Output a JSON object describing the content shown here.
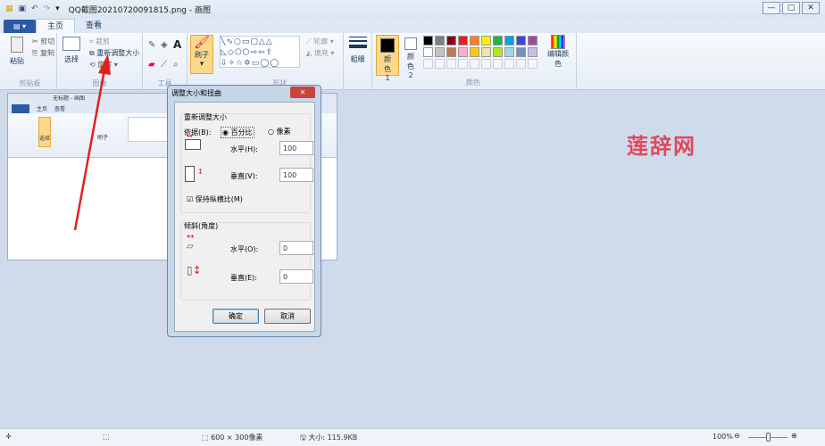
{
  "window": {
    "title": "QQ截图20210720091815.png - 画图",
    "min": "—",
    "max": "▢",
    "close": "✕"
  },
  "tabs": [
    {
      "label": "主页"
    },
    {
      "label": "查看"
    }
  ],
  "ribbon": {
    "clipboard": {
      "paste": "粘贴",
      "cut": "剪切",
      "copy": "复制",
      "label": "剪贴板"
    },
    "image": {
      "select": "选择",
      "crop": "裁剪",
      "resize": "重新调整大小",
      "rotate": "旋转",
      "label": "图像"
    },
    "tools": {
      "label": "工具",
      "text_icon": "A"
    },
    "brushes": {
      "label": "刷子"
    },
    "shapes": {
      "label": "形状",
      "outline": "轮廓",
      "fill": "填充"
    },
    "size": {
      "label": "粗细"
    },
    "colors": {
      "color1": "颜色 1",
      "color2": "颜色 2",
      "edit": "编辑颜色",
      "label": "颜色",
      "palette_row1": [
        "#000000",
        "#7f7f7f",
        "#880015",
        "#ed1c24",
        "#ff7f27",
        "#fff200",
        "#22b14c",
        "#00a2e8",
        "#3f48cc",
        "#a349a4"
      ],
      "palette_row2": [
        "#ffffff",
        "#c3c3c3",
        "#b97a57",
        "#ffaec9",
        "#ffc90e",
        "#efe4b0",
        "#b5e61d",
        "#99d9ea",
        "#7092be",
        "#c8bfe7"
      ]
    }
  },
  "embedded": {
    "title": "无标题 - 画图",
    "tab1": "主页",
    "tab2": "查看",
    "select": "选择",
    "brush": "刷子"
  },
  "dialog": {
    "title": "调整大小和扭曲",
    "resize_group": "重新调整大小",
    "by": "依据(B):",
    "percent": "百分比",
    "pixels": "像素",
    "horizontal": "水平(H):",
    "vertical": "垂直(V):",
    "h_value": "100",
    "v_value": "100",
    "keep_ratio": "保持纵横比(M)",
    "skew_group": "倾斜(角度)",
    "skew_h": "水平(O):",
    "skew_v": "垂直(E):",
    "skew_h_value": "0",
    "skew_v_value": "0",
    "ok": "确定",
    "cancel": "取消",
    "close": "✕"
  },
  "watermark": "莲辞网",
  "status": {
    "dimensions": "600 × 300像素",
    "size": "大小: 115.9KB",
    "zoom": "100%",
    "zoom_level": 100
  }
}
